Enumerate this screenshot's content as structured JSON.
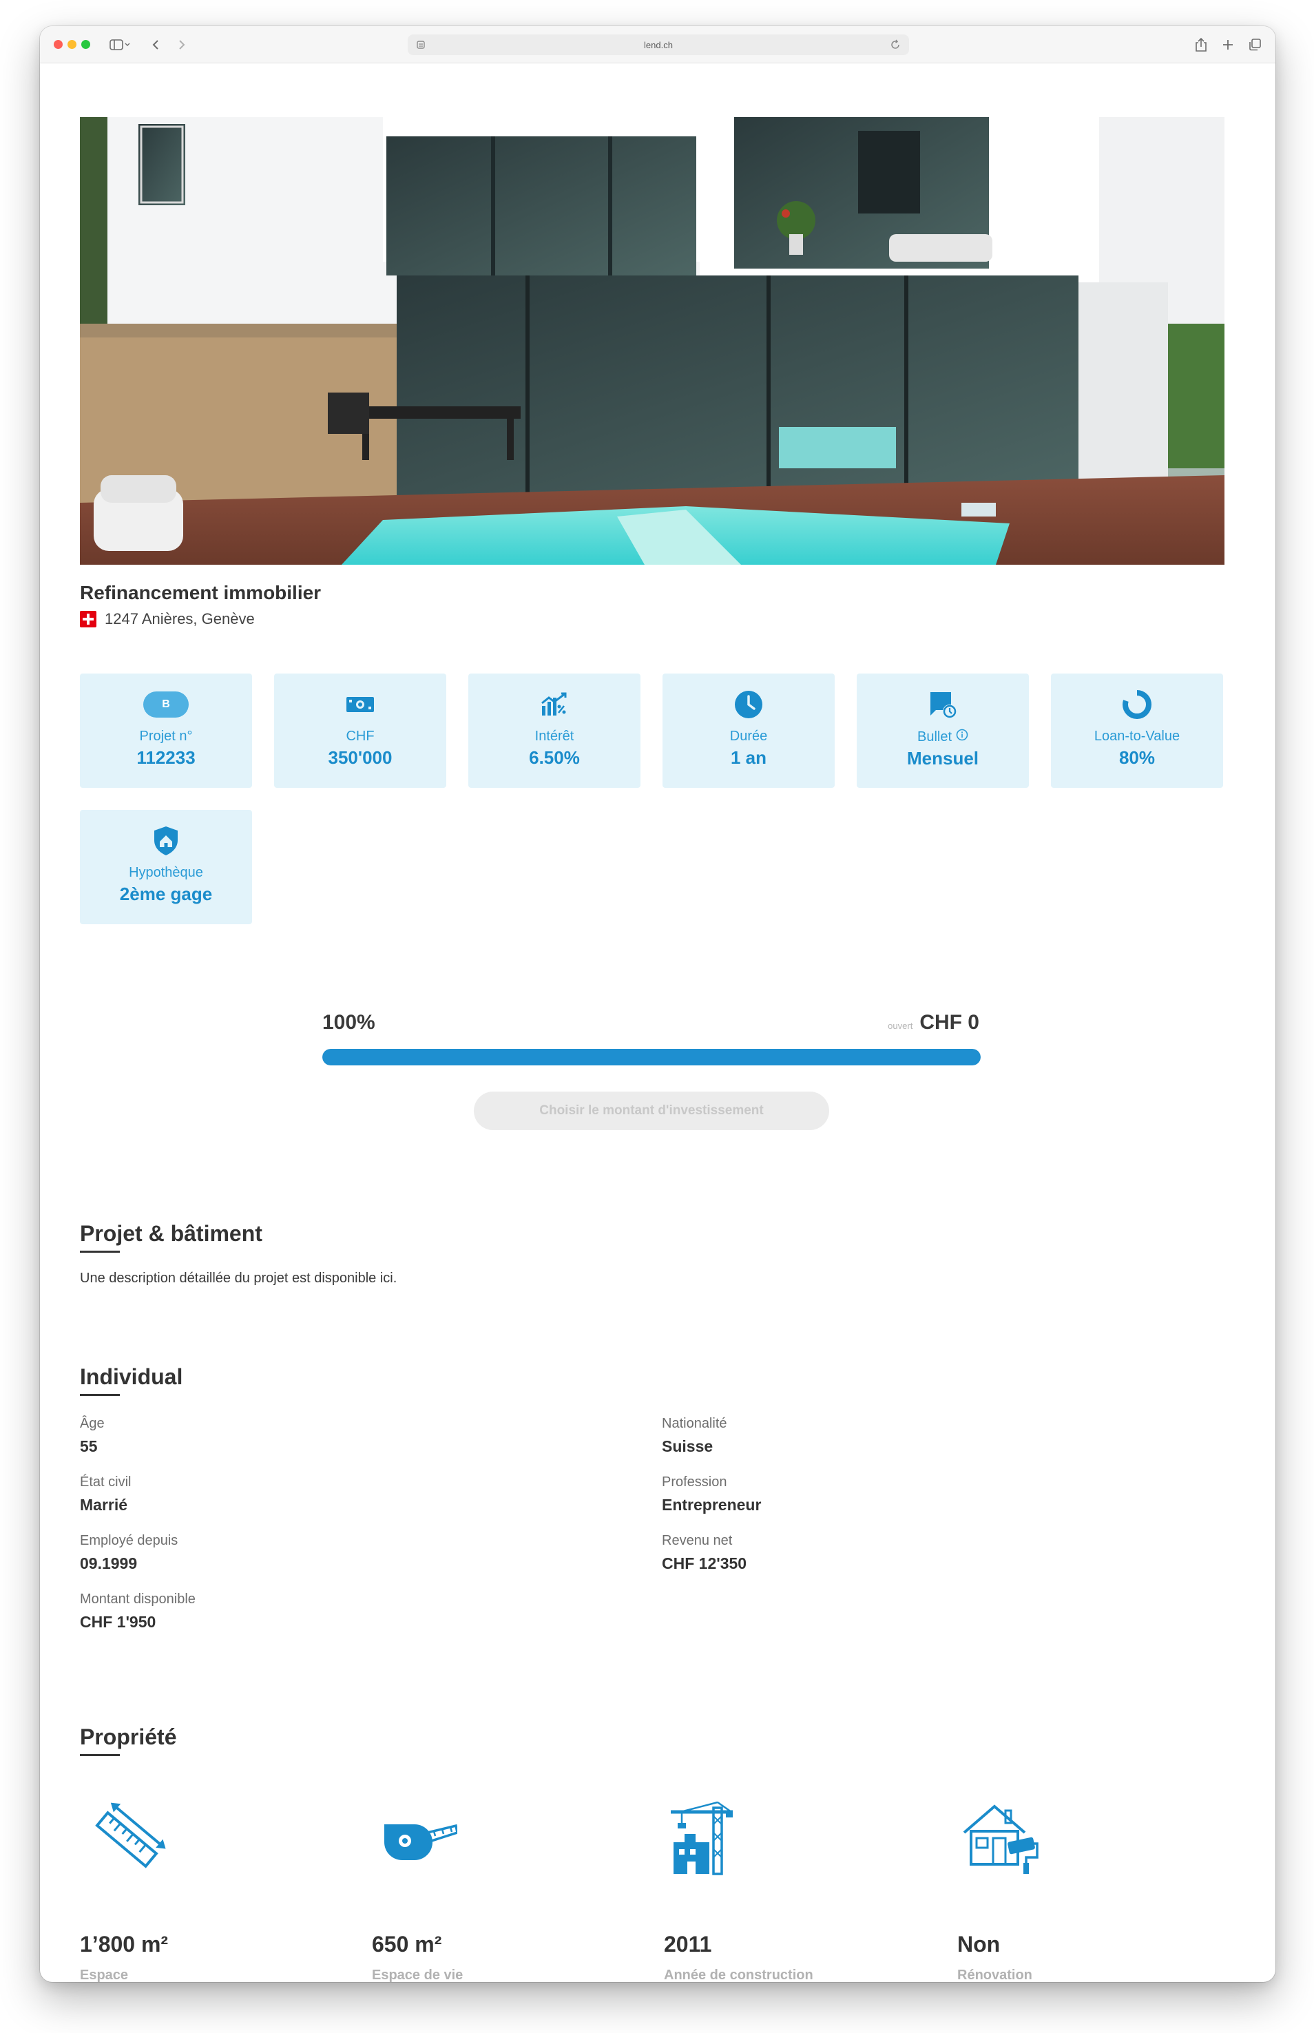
{
  "browser": {
    "url": "lend.ch"
  },
  "project": {
    "title": "Refinancement immobilier",
    "location": "1247 Anières, Genève"
  },
  "tiles": [
    {
      "icon": "rating-badge-icon",
      "badge": "B",
      "label": "Projet n°",
      "value": "112233"
    },
    {
      "icon": "banknote-icon",
      "label": "CHF",
      "value": "350'000"
    },
    {
      "icon": "interest-chart-icon",
      "label": "Intérêt",
      "value": "6.50%"
    },
    {
      "icon": "clock-icon",
      "label": "Durée",
      "value": "1 an"
    },
    {
      "icon": "calendar-clock-icon",
      "label": "Bullet",
      "value": "Mensuel"
    },
    {
      "icon": "ring-chart-icon",
      "label": "Loan-to-Value",
      "value": "80%"
    },
    {
      "icon": "shield-house-icon",
      "label": "Hypothèque",
      "value": "2ème gage"
    }
  ],
  "funding": {
    "percent_label": "100%",
    "progress_fraction": 1.0,
    "open_label": "ouvert",
    "open_amount": "CHF 0",
    "cta": "Choisir le montant d'investissement"
  },
  "project_section": {
    "title": "Projet & bâtiment",
    "description": "Une description détaillée du projet est disponible ici."
  },
  "individual": {
    "title": "Individual",
    "fields": {
      "age": {
        "label": "Âge",
        "value": "55"
      },
      "nationality": {
        "label": "Nationalité",
        "value": "Suisse"
      },
      "civil_status": {
        "label": "État civil",
        "value": "Marrié"
      },
      "profession": {
        "label": "Profession",
        "value": "Entrepreneur"
      },
      "employed_since": {
        "label": "Employé depuis",
        "value": "09.1999"
      },
      "net_income": {
        "label": "Revenu net",
        "value": "CHF 12'350"
      },
      "available_amount": {
        "label": "Montant disponible",
        "value": "CHF 1'950"
      }
    }
  },
  "property": {
    "title": "Propriété",
    "items": [
      {
        "icon": "ruler-icon",
        "value": "1’800 m²",
        "label": "Espace"
      },
      {
        "icon": "tape-measure-icon",
        "value": "650 m²",
        "label": "Espace de vie"
      },
      {
        "icon": "crane-building-icon",
        "value": "2011",
        "label": "Année de construction"
      },
      {
        "icon": "house-renovation-icon",
        "value": "Non",
        "label": "Rénovation"
      }
    ]
  },
  "colors": {
    "accent": "#1a8ccb",
    "tile_bg": "#e2f3fa",
    "progress": "#1e8fd0"
  }
}
